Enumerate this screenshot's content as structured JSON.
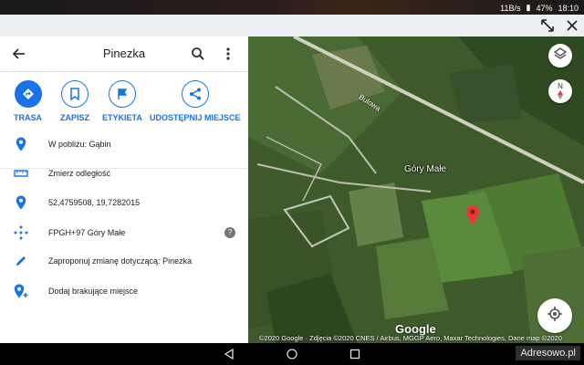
{
  "status_bar": {
    "network": "11B/s",
    "battery": "47%",
    "time": "18:10"
  },
  "pip_controls": {
    "expand_icon": "expand-diagonal-icon",
    "close_icon": "close-icon"
  },
  "panel": {
    "title": "Pinezka",
    "back_icon": "arrow-left-icon",
    "search_icon": "search-icon",
    "more_icon": "more-vertical-icon"
  },
  "actions": [
    {
      "label": "TRASA",
      "icon": "directions-icon"
    },
    {
      "label": "ZAPISZ",
      "icon": "bookmark-icon"
    },
    {
      "label": "ETYKIETA",
      "icon": "flag-icon"
    },
    {
      "label": "UDOSTĘPNIJ MIEJSCE",
      "icon": "share-icon"
    }
  ],
  "info_rows": [
    {
      "text": "W pobliżu: Gąbin",
      "icon": "location-pin-icon"
    },
    {
      "text": "Zmierz odległość",
      "icon": "ruler-icon"
    },
    {
      "text": "52,4759508, 19,7282015",
      "icon": "location-pin-icon"
    },
    {
      "text": "FPGH+97 Góry Małe",
      "icon": "plus-code-icon"
    },
    {
      "text": "Zaproponuj zmianę dotyczącą: Pinezka",
      "icon": "pencil-icon"
    },
    {
      "text": "Dodaj brakujące miejsce",
      "icon": "add-place-icon"
    }
  ],
  "map": {
    "road_label": "Bulowa",
    "village_label": "Góry Małe",
    "compass_label": "N",
    "google_logo": "Google",
    "attribution": "©2020 Google · Zdjęcia ©2020 CNES / Airbus, MGGP Aero, Maxar Technologies, Dane map ©2020",
    "pin_color": "#e53935",
    "accent": "#1a73e8"
  },
  "nav_bar": {
    "watermark": "Adresowo.pl"
  }
}
